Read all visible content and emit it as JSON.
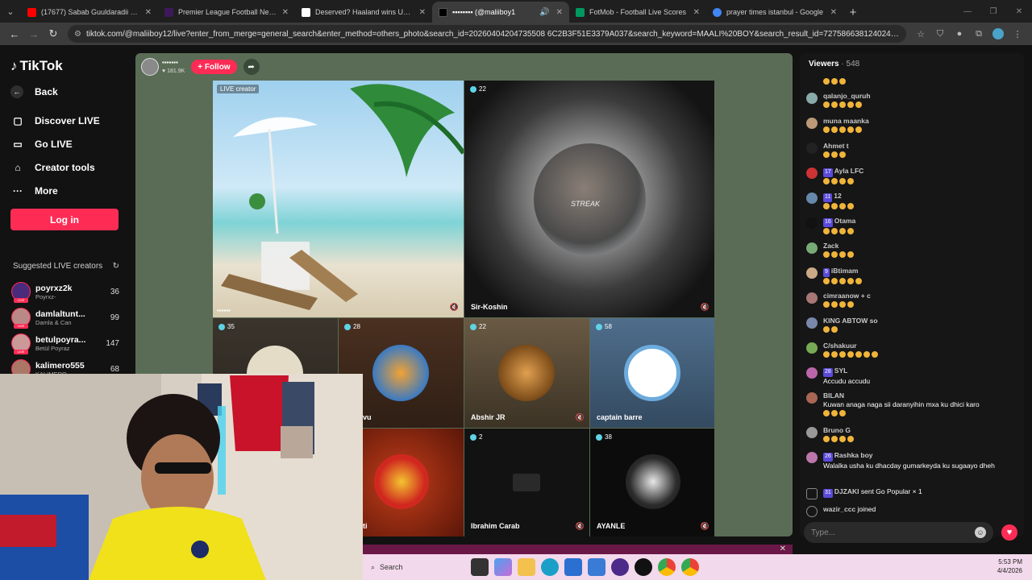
{
  "browser": {
    "tabs": [
      {
        "title": "(17677) Sabab Guuldaradii City",
        "color": "#ff0000",
        "active": false
      },
      {
        "title": "Premier League Football News,",
        "color": "#3d195b",
        "active": false
      },
      {
        "title": "Deserved? Haaland wins UEFA",
        "color": "#ffffff",
        "active": false
      },
      {
        "title": "▪▪▪▪▪▪▪▪ (@maliiboy1",
        "color": "#000000",
        "active": true
      },
      {
        "title": "FotMob - Football Live Scores",
        "color": "#00985f",
        "active": false
      },
      {
        "title": "prayer times istanbul - Google",
        "color": "#4285f4",
        "active": false
      }
    ],
    "url": "tiktok.com/@maliiboy12/live?enter_from_merge=general_search&enter_method=others_photo&search_id=20260404204735508 6C2B3F51E3379A037&search_keyword=MAALI%20BOY&search_result_id=7275866381240248388search_type=..."
  },
  "sidebar": {
    "logo": "TikTok",
    "back": "Back",
    "items": [
      {
        "label": "Discover LIVE"
      },
      {
        "label": "Go LIVE"
      },
      {
        "label": "Creator tools"
      },
      {
        "label": "More"
      }
    ],
    "login": "Log in",
    "suggested_title": "Suggested LIVE creators",
    "creators": [
      {
        "name": "poyrxz2k",
        "sub": "Poyrxz-",
        "count": "36"
      },
      {
        "name": "damlaltunt...",
        "sub": "Damla & Can",
        "count": "99"
      },
      {
        "name": "betulpoyra...",
        "sub": "Betül Poyraz",
        "count": "147"
      },
      {
        "name": "kalimero555",
        "sub": "KALIMERO",
        "count": "68"
      }
    ]
  },
  "host": {
    "name": "▪▪▪▪▪▪▪",
    "likes": "181.9K",
    "follow": "+ Follow"
  },
  "grid": {
    "main_left": {
      "tag": "LIVE creator",
      "label": "▪▪▪▪▪▪"
    },
    "main_right": {
      "count": "22",
      "name": "Sir-Koshin",
      "overlay": "STREAK"
    },
    "row2": [
      {
        "count": "35",
        "name": ""
      },
      {
        "count": "28",
        "name": "vu"
      },
      {
        "count": "22",
        "name": "Abshir JR"
      },
      {
        "count": "58",
        "name": "captain barre"
      }
    ],
    "row3": [
      {
        "count": "",
        "name": "ti"
      },
      {
        "count": "2",
        "name": "Ibrahim Carab"
      },
      {
        "count": "38",
        "name": "AYANLE"
      }
    ]
  },
  "chat": {
    "viewers_label": "Viewers",
    "viewers_count": "· 548",
    "messages": [
      {
        "name": "qalanjo_quruh",
        "text": "",
        "color": "#8aa"
      },
      {
        "name": "muna maanka",
        "text": "",
        "color": "#b97"
      },
      {
        "name": "Ahmet t",
        "text": "",
        "color": "#222"
      },
      {
        "name": "Ayla LFC",
        "badge": "17",
        "text": "",
        "color": "#c33"
      },
      {
        "name": "12",
        "badge": "11",
        "text": "",
        "color": "#68a"
      },
      {
        "name": "Otama",
        "badge": "16",
        "text": "",
        "color": "#111"
      },
      {
        "name": "Zack",
        "text": "",
        "color": "#7a7"
      },
      {
        "name": "iBtimam",
        "badge": "9",
        "text": "",
        "color": "#ca8"
      },
      {
        "name": "cimraanow + c",
        "text": "",
        "color": "#a77"
      },
      {
        "name": "KING ABTOW so",
        "text": "",
        "color": "#78a"
      },
      {
        "name": "C/shakuur",
        "text": "",
        "color": "#7a5"
      },
      {
        "name": "SYL",
        "badge": "28",
        "text": "Accudu accudu",
        "color": "#b6a"
      },
      {
        "name": "BILAN",
        "text": "Kuwan anaga naga sii daranyihin mxa ku dhici karo",
        "color": "#a65"
      },
      {
        "name": "Bruno G",
        "text": "",
        "color": "#999"
      },
      {
        "name": "Rashka boy",
        "badge": "26",
        "text": "Walalka usha ku dhacday gumarkeyda ku sugaayo dheh",
        "color": "#b7a"
      },
      {
        "name": "DJZAKI",
        "badge": "31",
        "text": "sent Go Popular × 1",
        "color": "#555"
      },
      {
        "name": "wazir_ccc",
        "text": "joined",
        "color": "#555"
      }
    ],
    "input_placeholder": "Type..."
  },
  "taskbar": {
    "search": "Search",
    "time": "5:53 PM",
    "date": "4/4/2026"
  }
}
